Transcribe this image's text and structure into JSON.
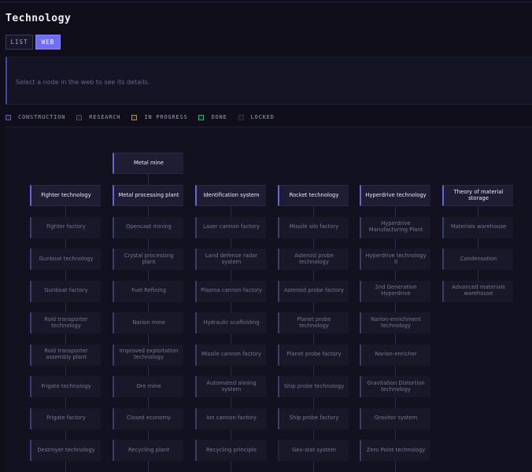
{
  "title": "Technology",
  "view_toggle": {
    "list_label": "LIST",
    "web_label": "WEB",
    "active": "WEB"
  },
  "details": {
    "placeholder": "Select a node in the web to see its details."
  },
  "legend": [
    {
      "label": "CONSTRUCTION",
      "color": "#5a5ae0"
    },
    {
      "label": "RESEARCH",
      "color": "#45457a"
    },
    {
      "label": "IN PROGRESS",
      "color": "#c08a30"
    },
    {
      "label": "DONE",
      "color": "#2fae7f"
    },
    {
      "label": "LOCKED",
      "color": "#303048"
    }
  ],
  "colors": {
    "accent": "#6f6ff5",
    "background": "#0f0e1a",
    "node": "#191829"
  },
  "web": {
    "top_node": "Metal mine",
    "columns": [
      {
        "head": "Fighter technology",
        "items": [
          "Fighter factory",
          "Gunboat technology",
          "Gunboat factory",
          "Roid transporter technology",
          "Roid transporter assembly plant",
          "Frigate technology",
          "Frigate factory",
          "Destroyer technology"
        ]
      },
      {
        "head": "Metal processing plant",
        "items": [
          "Opencast mining",
          "Crystal processing plant",
          "Fuel Refining",
          "Narion mine",
          "Improved exploitation technology",
          "Ore mine",
          "Closed economy",
          "Recycling plant"
        ]
      },
      {
        "head": "Identification system",
        "items": [
          "Laser cannon factory",
          "Land defense radar system",
          "Plasma cannon factory",
          "Hydraulic scaffolding",
          "Missile cannon factory",
          "Automated aiming system",
          "Ion cannon factory",
          "Recycling principle"
        ]
      },
      {
        "head": "Rocket technology",
        "items": [
          "Missile silo factory",
          "Asteroid probe technology",
          "Asteroid probe factory",
          "Planet probe technology",
          "Planet probe factory",
          "Ship probe technology",
          "Ship probe factory",
          "Geo-stat system"
        ]
      },
      {
        "head": "Hyperdrive technology",
        "items": [
          "Hyperdrive Manufacturing Plant",
          "Hyperdrive technology II",
          "2nd Generation Hyperdrive",
          "Narion-enrichment technology",
          "Narion-enricher",
          "Gravitation Distortion technology",
          "Gravitor system",
          "Zero Point technology"
        ]
      },
      {
        "head": "Theory of material storage",
        "items": [
          "Materials warehouse",
          "Condensation",
          "Advanced materials warehouse"
        ]
      }
    ]
  }
}
